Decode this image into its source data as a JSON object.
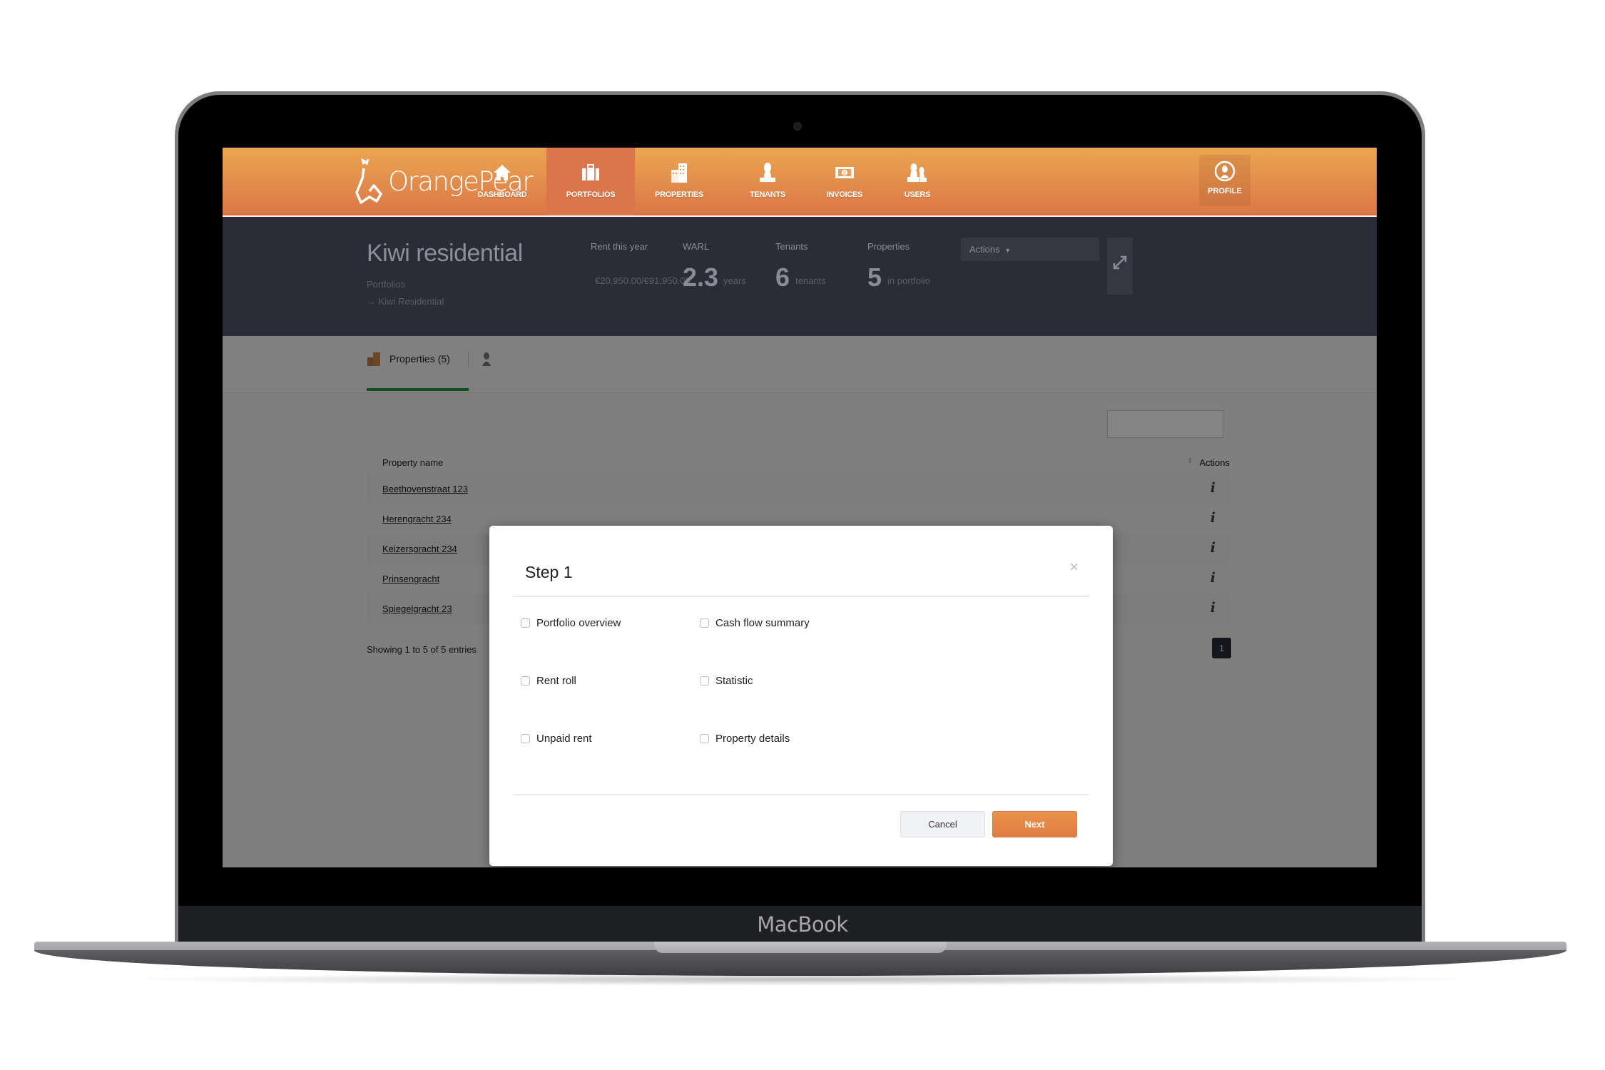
{
  "device": {
    "label": "MacBook"
  },
  "app": {
    "brand": "OrangePear",
    "accent_color": "#e8924b",
    "header_gradient": [
      "#eba650",
      "#db7748"
    ],
    "nav": [
      {
        "label": "DASHBOARD",
        "icon": "home-icon",
        "active": false
      },
      {
        "label": "PORTFOLIOS",
        "icon": "briefcase-icon",
        "active": true
      },
      {
        "label": "PROPERTIES",
        "icon": "building-icon",
        "active": false
      },
      {
        "label": "TENANTS",
        "icon": "person-icon",
        "active": false
      },
      {
        "label": "INVOICES",
        "icon": "banknote-icon",
        "active": false
      },
      {
        "label": "USERS",
        "icon": "users-icon",
        "active": false
      }
    ],
    "profile": {
      "label": "PROFILE",
      "icon": "user-circle-icon"
    }
  },
  "portfolio": {
    "title": "Kiwi residential",
    "breadcrumb": [
      "Portfolios",
      "→ Kiwi Residential"
    ],
    "stats": {
      "rent": {
        "label": "Rent this year",
        "value": "€20,950.00/€91,950.00"
      },
      "warl": {
        "label": "WARL",
        "value": "2.3",
        "unit": "years"
      },
      "tenants": {
        "label": "Tenants",
        "value": "6",
        "unit": "tenants"
      },
      "properties": {
        "label": "Properties",
        "value": "5",
        "unit": "in portfolio"
      }
    },
    "actions_label": "Actions"
  },
  "tabs": [
    {
      "label": "Properties (5)",
      "active": true,
      "icon": "building-icon"
    },
    {
      "label": "",
      "active": false,
      "icon": "person-icon"
    }
  ],
  "table": {
    "columns": [
      "Property name",
      "Actions"
    ],
    "rows": [
      {
        "name": "Beethovenstraat 123"
      },
      {
        "name": "Herengracht 234"
      },
      {
        "name": "Keizersgracht 234"
      },
      {
        "name": "Prinsengracht"
      },
      {
        "name": "Spiegelgracht 23"
      }
    ],
    "footer": "Showing 1 to 5 of 5 entries",
    "current_page": "1"
  },
  "modal": {
    "title": "Step 1",
    "close": "×",
    "options": [
      {
        "label": "Portfolio overview",
        "checked": false
      },
      {
        "label": "Cash flow summary",
        "checked": false
      },
      {
        "label": "Rent roll",
        "checked": false
      },
      {
        "label": "Statistic",
        "checked": false
      },
      {
        "label": "Unpaid rent",
        "checked": false
      },
      {
        "label": "Property details",
        "checked": false
      }
    ],
    "cancel_label": "Cancel",
    "next_label": "Next"
  }
}
